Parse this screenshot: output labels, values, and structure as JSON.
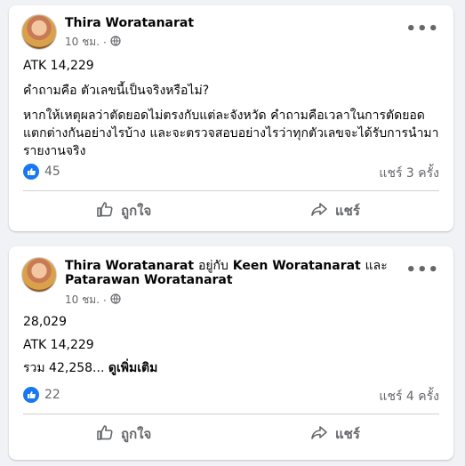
{
  "posts": [
    {
      "author": "Thira Woratanarat",
      "time": "10 ชม.",
      "dot": "·",
      "lines": [
        "ATK 14,229",
        "คำถามคือ ตัวเลขนี้เป็นจริงหรือไม่?"
      ],
      "paragraph": "หากให้เหตุผลว่าตัดยอดไม่ตรงกับแต่ละจังหวัด คำถามคือเวลาในการตัดยอดแตกต่างกันอย่างไรบ้าง และจะตรวจสอบอย่างไรว่าทุกตัวเลขจะได้รับการนำมารายงานจริง",
      "likes": "45",
      "shares": "แชร์ 3 ครั้ง",
      "like_label": "ถูกใจ",
      "share_label": "แชร์"
    },
    {
      "author": "Thira Woratanarat",
      "with_text": "อยู่กับ",
      "tagged1": "Keen Woratanarat",
      "and_text": "และ",
      "tagged2": "Patarawan Woratanarat",
      "time": "10 ชม.",
      "dot": "·",
      "lines": [
        "28,029",
        "ATK 14,229"
      ],
      "sum_text": "รวม 42,258...",
      "see_more": "ดูเพิ่มเติม",
      "likes": "22",
      "shares": "แชร์ 4 ครั้ง",
      "like_label": "ถูกใจ",
      "share_label": "แชร์"
    }
  ],
  "icons": {
    "more": "more-options-icon",
    "privacy": "globe-icon",
    "like": "thumbs-up-icon",
    "share": "share-arrow-icon"
  },
  "colors": {
    "accent": "#1877f2",
    "secondary_text": "#65676b",
    "background": "#f0f2f5"
  }
}
